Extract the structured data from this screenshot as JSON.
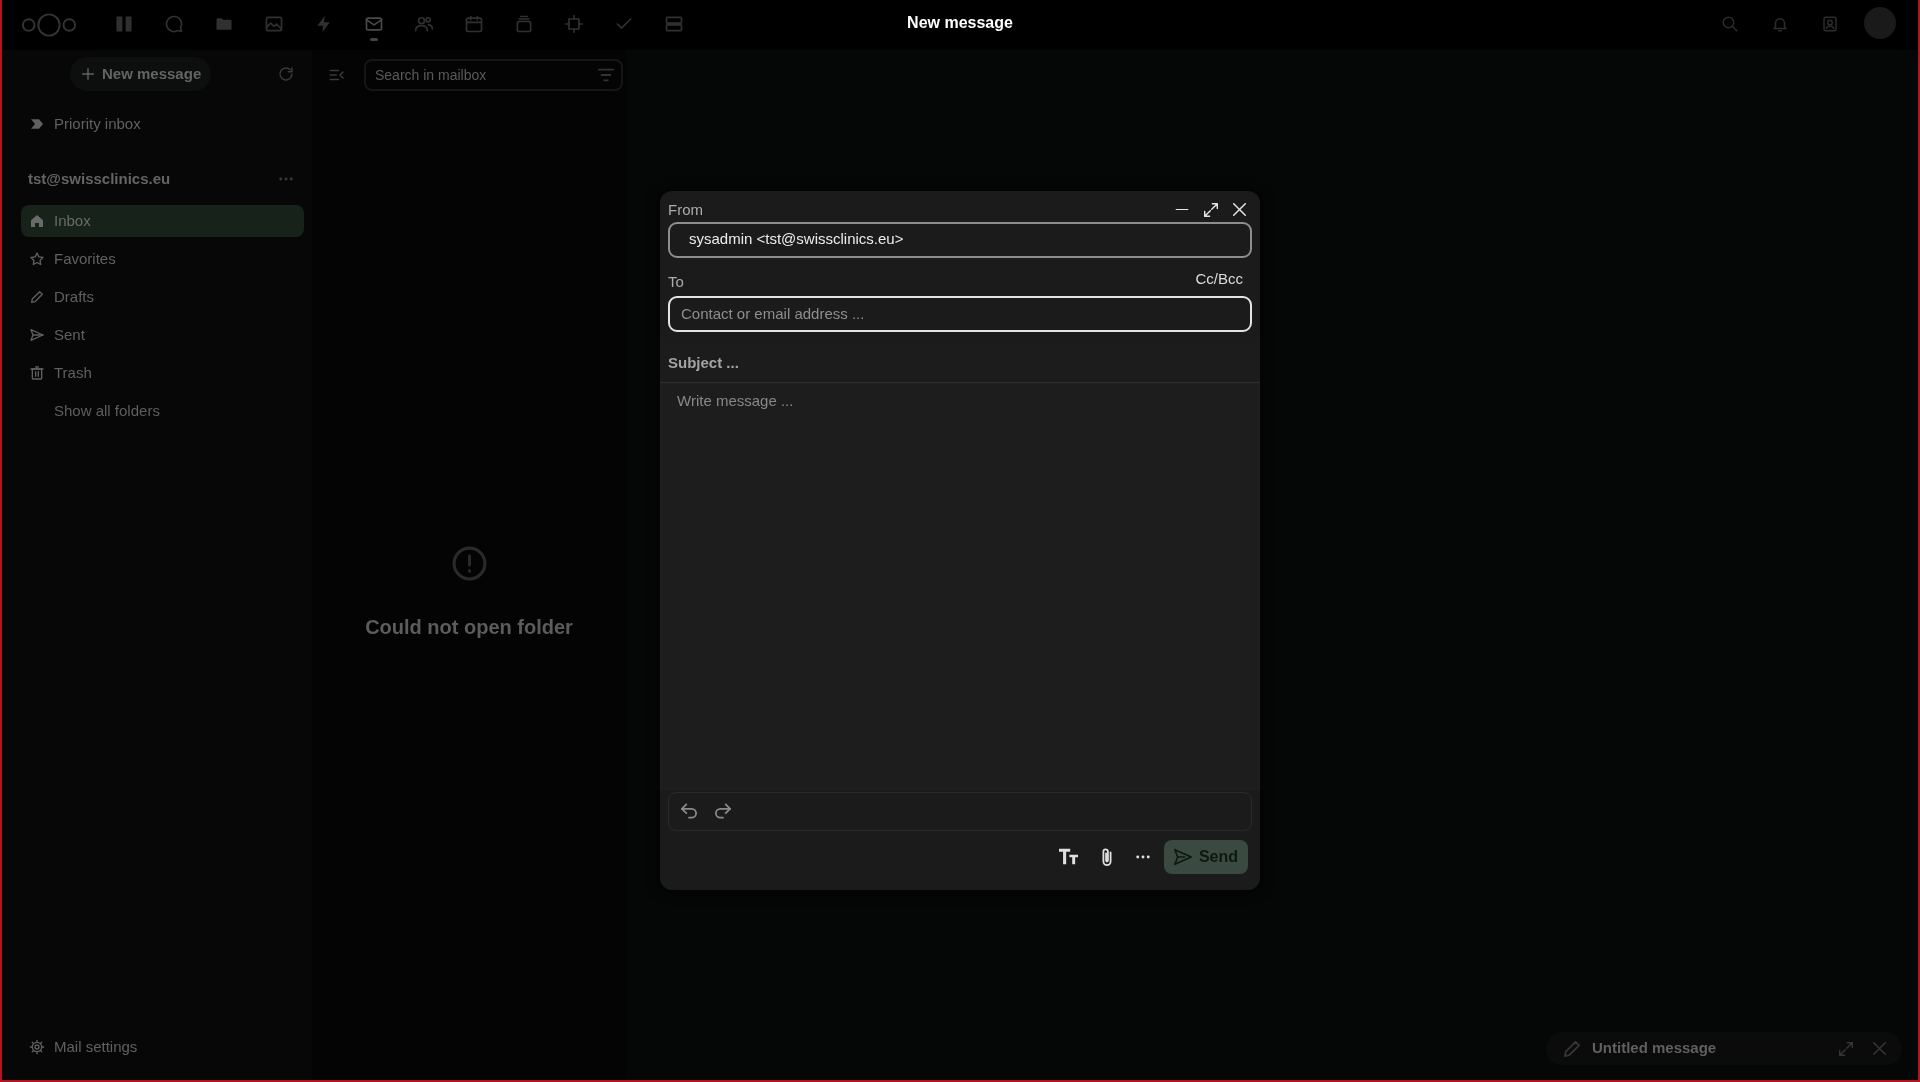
{
  "header": {
    "apps": [
      {
        "kind": "dashboard",
        "selected": false
      },
      {
        "kind": "talk",
        "selected": false
      },
      {
        "kind": "files",
        "selected": false
      },
      {
        "kind": "photos",
        "selected": false
      },
      {
        "kind": "activity",
        "selected": false
      },
      {
        "kind": "mail",
        "selected": true
      },
      {
        "kind": "contacts",
        "selected": false
      },
      {
        "kind": "calendar",
        "selected": false
      },
      {
        "kind": "deck",
        "selected": false
      },
      {
        "kind": "tables",
        "selected": false
      },
      {
        "kind": "tasks",
        "selected": false
      },
      {
        "kind": "storage",
        "selected": false
      }
    ]
  },
  "sidebar": {
    "new_message": "New message",
    "priority_inbox": "Priority inbox",
    "account": "tst@swissclinics.eu",
    "folders": [
      {
        "kind": "inbox",
        "label": "Inbox",
        "selected": true
      },
      {
        "kind": "favorites",
        "label": "Favorites",
        "selected": false
      },
      {
        "kind": "drafts",
        "label": "Drafts",
        "selected": false
      },
      {
        "kind": "sent",
        "label": "Sent",
        "selected": false
      },
      {
        "kind": "trash",
        "label": "Trash",
        "selected": false
      }
    ],
    "show_all": "Show all folders",
    "settings": "Mail settings"
  },
  "message_list": {
    "search": {
      "placeholder": "Search in mailbox"
    },
    "empty_message": "Could not open folder"
  },
  "composer": {
    "title": "New message",
    "from": {
      "label": "From",
      "value": "sysadmin <tst@swissclinics.eu>"
    },
    "to": {
      "label": "To",
      "placeholder": "Contact or email address ..."
    },
    "cc_bcc": "Cc/Bcc",
    "subject": {
      "placeholder": "Subject ..."
    },
    "body": {
      "placeholder": "Write message ..."
    },
    "send": "Send"
  },
  "minimized_composer": {
    "title": "Untitled message"
  }
}
